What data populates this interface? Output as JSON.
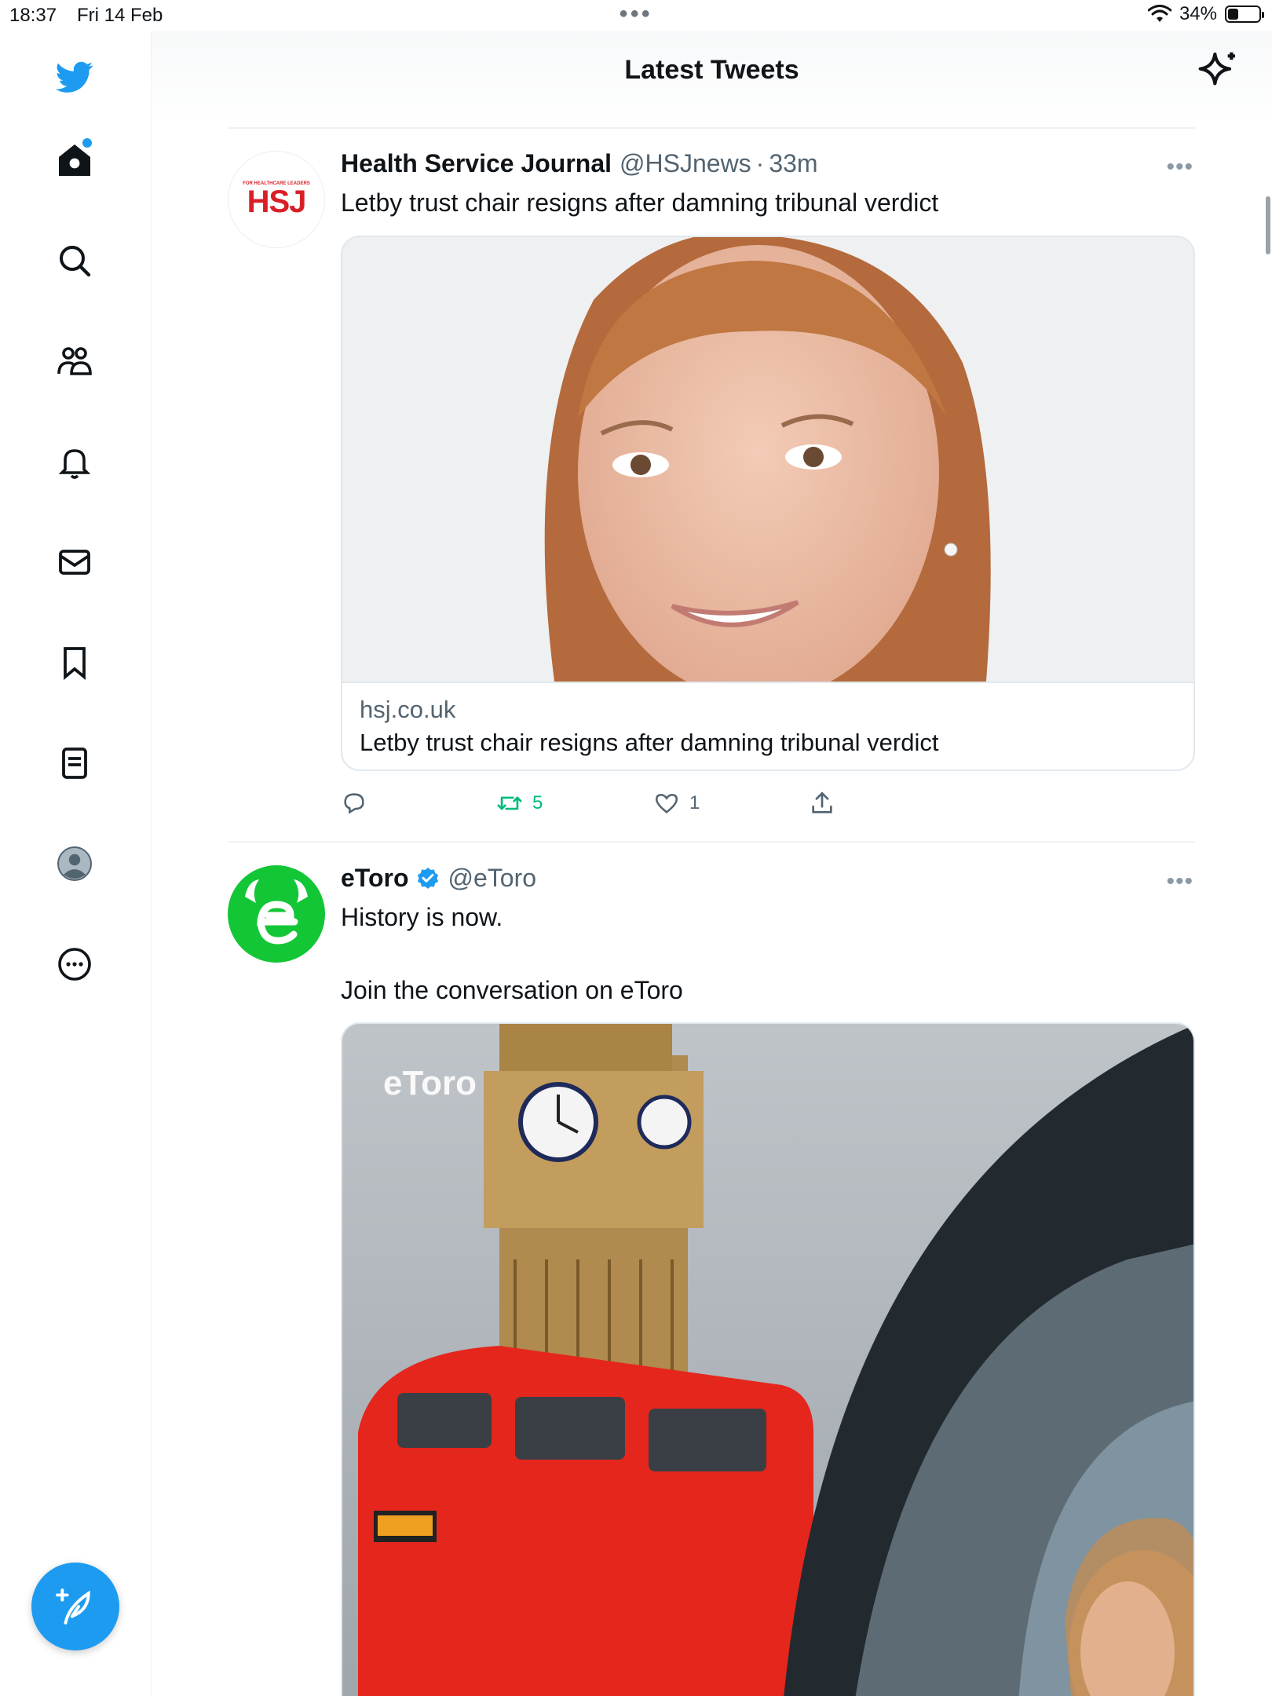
{
  "status": {
    "time": "18:37",
    "date": "Fri 14 Feb",
    "battery": "34%",
    "battery_level": 0.34
  },
  "header": {
    "title": "Latest Tweets"
  },
  "sidebar": {
    "items": [
      "twitter-logo",
      "home-icon",
      "search-icon",
      "communities-icon",
      "notifications-icon",
      "messages-icon",
      "bookmarks-icon",
      "lists-icon",
      "profile-icon",
      "more-icon"
    ]
  },
  "tweets": [
    {
      "name": "Health Service Journal",
      "handle": "@HSJnews",
      "sep": "·",
      "time": "33m",
      "avatar_text": "HSJ",
      "avatar_tag": "FOR HEALTHCARE LEADERS",
      "text": "Letby trust chair resigns after damning tribunal verdict",
      "card": {
        "domain": "hsj.co.uk",
        "title": "Letby trust chair resigns after damning tribunal verdict"
      },
      "actions": {
        "retweets": "5",
        "likes": "1"
      }
    },
    {
      "name": "eToro",
      "handle": "@eToro",
      "verified": true,
      "line1": "History is now.",
      "line2": "Join the conversation on eToro",
      "image_watermark": "eToro"
    }
  ],
  "colors": {
    "accent": "#1d9bf0",
    "retweet": "#00ba7c",
    "hsj_red": "#d91f26",
    "etoro_green": "#13c636"
  }
}
